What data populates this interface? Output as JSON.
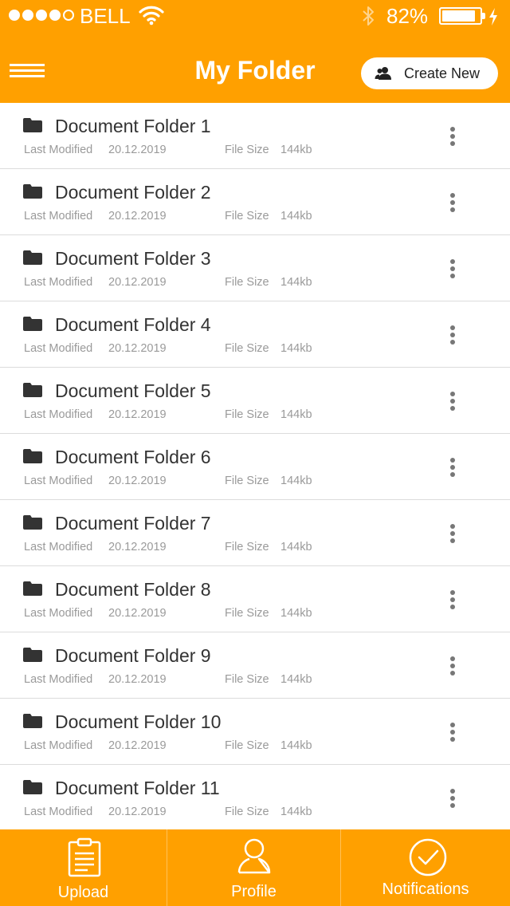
{
  "status_bar": {
    "carrier": "BELL",
    "battery_percent": "82%",
    "signal_bars_filled": 4,
    "signal_bars_total": 5,
    "battery_level": 0.82
  },
  "header": {
    "title": "My Folder",
    "create_button_label": "Create New",
    "menu_icon": "hamburger-menu-icon",
    "create_icon": "users-icon",
    "background_color": "#FFA000"
  },
  "folders": [
    {
      "name": "Document Folder 1",
      "modified_label": "Last Modified",
      "modified": "20.12.2019",
      "size_label": "File Size",
      "size": "144kb"
    },
    {
      "name": "Document Folder 2",
      "modified_label": "Last Modified",
      "modified": "20.12.2019",
      "size_label": "File Size",
      "size": "144kb"
    },
    {
      "name": "Document Folder 3",
      "modified_label": "Last Modified",
      "modified": "20.12.2019",
      "size_label": "File Size",
      "size": "144kb"
    },
    {
      "name": "Document Folder 4",
      "modified_label": "Last Modified",
      "modified": "20.12.2019",
      "size_label": "File Size",
      "size": "144kb"
    },
    {
      "name": "Document Folder 5",
      "modified_label": "Last Modified",
      "modified": "20.12.2019",
      "size_label": "File Size",
      "size": "144kb"
    },
    {
      "name": "Document Folder 6",
      "modified_label": "Last Modified",
      "modified": "20.12.2019",
      "size_label": "File Size",
      "size": "144kb"
    },
    {
      "name": "Document Folder 7",
      "modified_label": "Last Modified",
      "modified": "20.12.2019",
      "size_label": "File Size",
      "size": "144kb"
    },
    {
      "name": "Document Folder 8",
      "modified_label": "Last Modified",
      "modified": "20.12.2019",
      "size_label": "File Size",
      "size": "144kb"
    },
    {
      "name": "Document Folder 9",
      "modified_label": "Last Modified",
      "modified": "20.12.2019",
      "size_label": "File Size",
      "size": "144kb"
    },
    {
      "name": "Document Folder 10",
      "modified_label": "Last Modified",
      "modified": "20.12.2019",
      "size_label": "File Size",
      "size": "144kb"
    },
    {
      "name": "Document Folder 11",
      "modified_label": "Last Modified",
      "modified": "20.12.2019",
      "size_label": "File Size",
      "size": "144kb"
    }
  ],
  "tabbar": {
    "tabs": [
      {
        "label": "Upload",
        "icon": "clipboard-icon"
      },
      {
        "label": "Profile",
        "icon": "user-icon"
      },
      {
        "label": "Notifications",
        "icon": "check-circle-icon"
      }
    ],
    "background_color": "#FFA000"
  }
}
